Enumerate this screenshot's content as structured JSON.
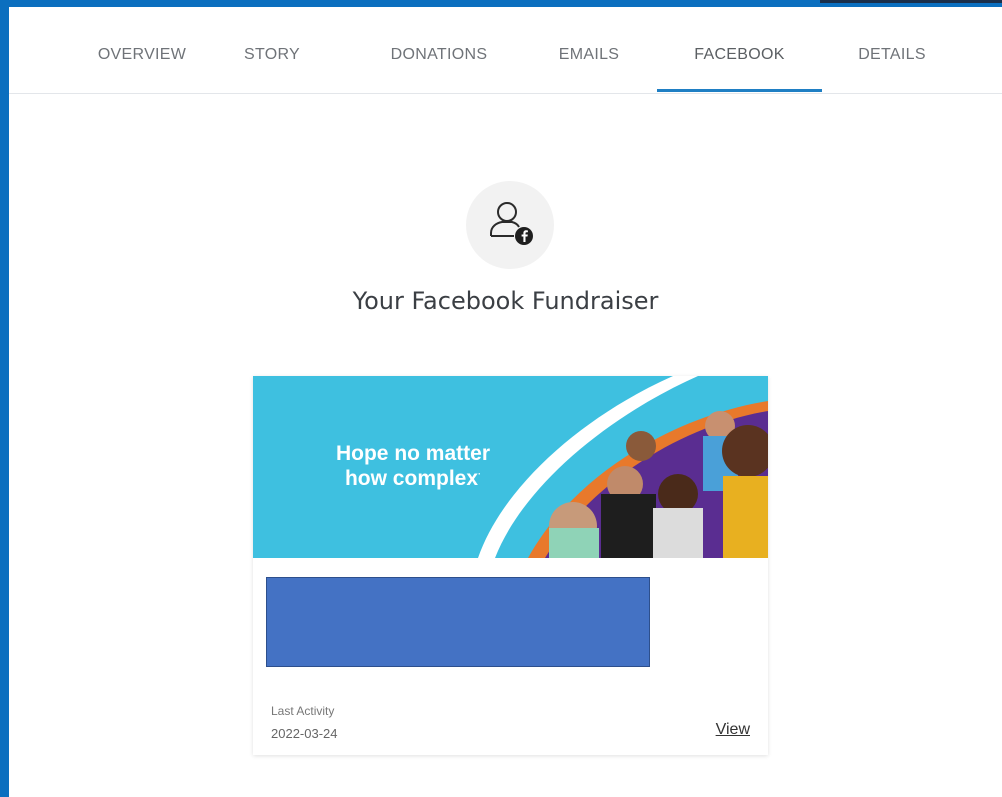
{
  "tabs": [
    {
      "label": "OVERVIEW",
      "active": false
    },
    {
      "label": "STORY",
      "active": false
    },
    {
      "label": "DONATIONS",
      "active": false
    },
    {
      "label": "EMAILS",
      "active": false
    },
    {
      "label": "FACEBOOK",
      "active": true
    },
    {
      "label": "DETAILS",
      "active": false
    }
  ],
  "colors": {
    "frame": "#0b6fbf",
    "tab_underline": "#1f7fc4",
    "banner_bg": "#3ec0e0",
    "redaction": "#4472c4"
  },
  "main": {
    "icon": "user-facebook-icon",
    "heading": "Your Facebook Fundraiser"
  },
  "card": {
    "banner_line1": "Hope no matter",
    "banner_line2": "how complex",
    "banner_mark": "·",
    "last_activity_label": "Last Activity",
    "last_activity_date": "2022-03-24",
    "view_label": "View"
  }
}
